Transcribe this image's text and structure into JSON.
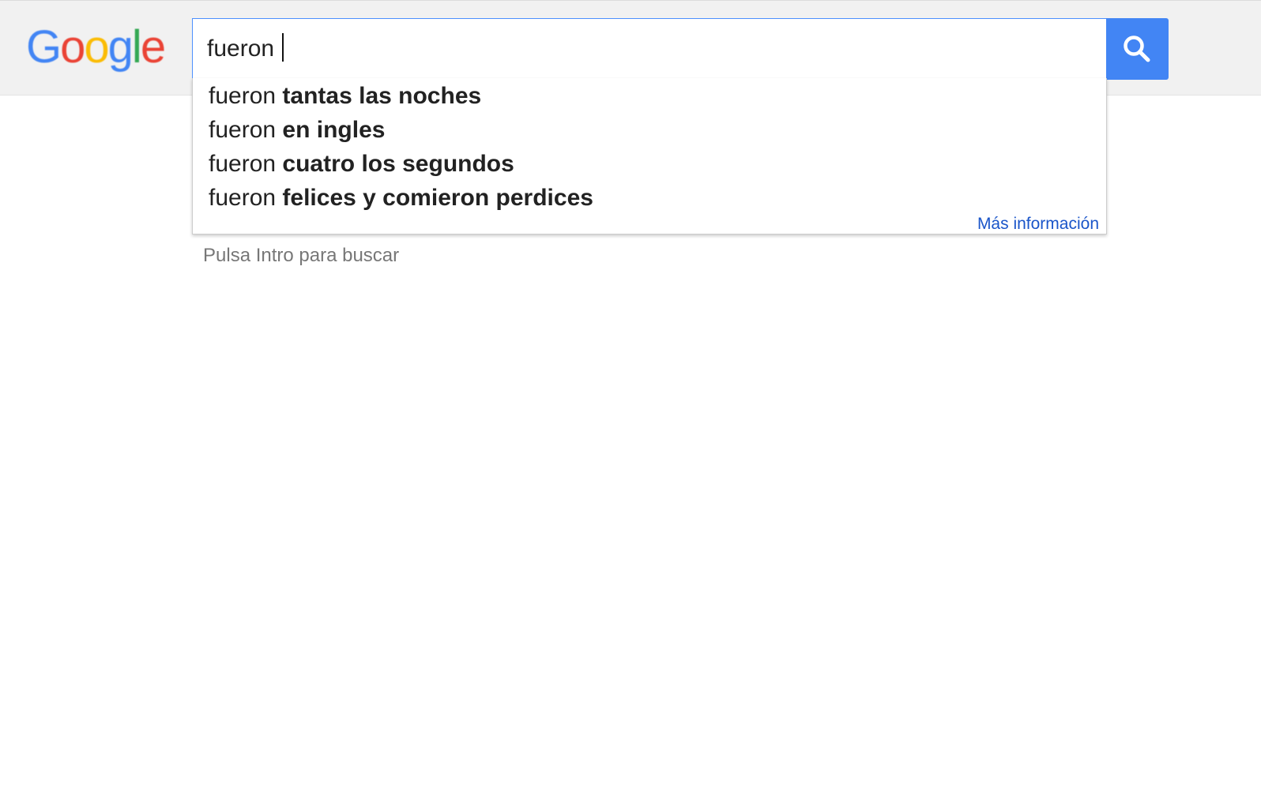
{
  "header": {
    "logo": {
      "letters": [
        {
          "char": "G",
          "color": "#4285f4"
        },
        {
          "char": "o",
          "color": "#ea4335"
        },
        {
          "char": "o",
          "color": "#fbbc05"
        },
        {
          "char": "g",
          "color": "#4285f4"
        },
        {
          "char": "l",
          "color": "#34a853"
        },
        {
          "char": "e",
          "color": "#ea4335"
        }
      ]
    },
    "search": {
      "query": "fueron",
      "button_icon": "search-icon",
      "button_color": "#4285f4"
    }
  },
  "autocomplete": {
    "suggestions": [
      {
        "prefix": "fueron",
        "completion": "tantas las noches"
      },
      {
        "prefix": "fueron",
        "completion": "en ingles"
      },
      {
        "prefix": "fueron",
        "completion": "cuatro los segundos"
      },
      {
        "prefix": "fueron",
        "completion": "felices y comieron perdices"
      }
    ],
    "more_info_label": "Más información",
    "link_color": "#1a55c9"
  },
  "hint": {
    "text": "Pulsa Intro para buscar"
  }
}
